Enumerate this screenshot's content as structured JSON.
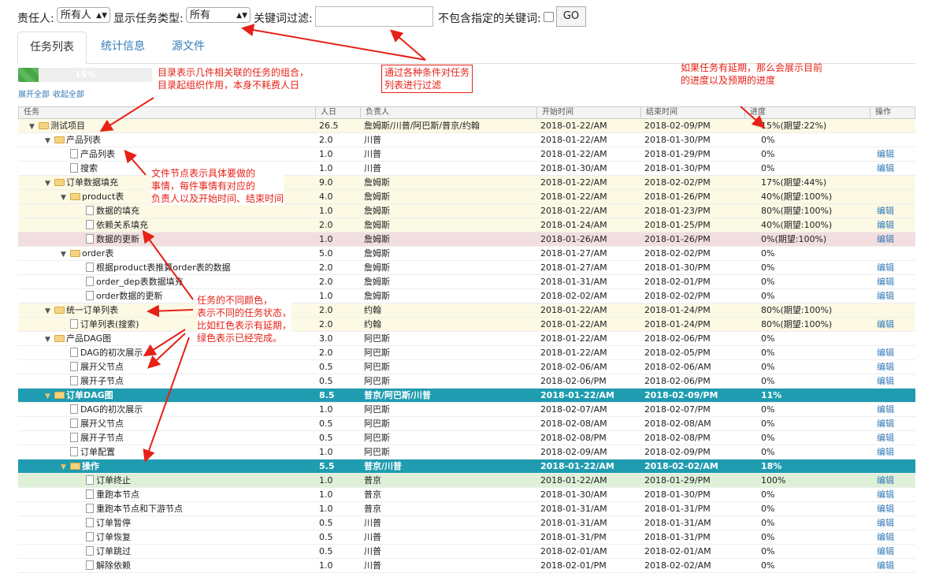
{
  "filters": {
    "owner_label": "责任人:",
    "owner_value": "所有人",
    "type_label": "显示任务类型:",
    "type_value": "所有",
    "keyword_label": "关键词过滤:",
    "keyword_value": "",
    "exclude_label": "不包含指定的关键词:",
    "go_label": "GO"
  },
  "tabs": [
    {
      "label": "任务列表",
      "active": true
    },
    {
      "label": "统计信息",
      "active": false
    },
    {
      "label": "源文件",
      "active": false
    }
  ],
  "progress": {
    "value": 0.15,
    "label": "15%"
  },
  "expand": {
    "expand_all": "展开全部",
    "collapse_all": "收起全部"
  },
  "columns": [
    "任务",
    "人日",
    "负责人",
    "开始时间",
    "结束时间",
    "进度",
    "操作"
  ],
  "rows": [
    {
      "name": "测试项目",
      "level": 0,
      "kind": "folder",
      "expanded": true,
      "days": "26.5",
      "owner": "詹姆斯/川普/阿巴斯/普京/约翰",
      "start": "2018-01-22/AM",
      "end": "2018-02-09/PM",
      "progress": "15%(期望:22%)",
      "action": "",
      "color": "yellow"
    },
    {
      "name": "产品列表",
      "level": 1,
      "kind": "folder",
      "expanded": true,
      "days": "2.0",
      "owner": "川普",
      "start": "2018-01-22/AM",
      "end": "2018-01-30/PM",
      "progress": "0%",
      "action": "",
      "color": ""
    },
    {
      "name": "产品列表",
      "level": 2,
      "kind": "file",
      "days": "1.0",
      "owner": "川普",
      "start": "2018-01-22/AM",
      "end": "2018-01-29/PM",
      "progress": "0%",
      "action": "编辑",
      "color": ""
    },
    {
      "name": "搜索",
      "level": 2,
      "kind": "file",
      "days": "1.0",
      "owner": "川普",
      "start": "2018-01-30/AM",
      "end": "2018-01-30/PM",
      "progress": "0%",
      "action": "编辑",
      "color": ""
    },
    {
      "name": "订单数据填充",
      "level": 1,
      "kind": "folder",
      "expanded": true,
      "days": "9.0",
      "owner": "詹姆斯",
      "start": "2018-01-22/AM",
      "end": "2018-02-02/PM",
      "progress": "17%(期望:44%)",
      "action": "",
      "color": "yellow"
    },
    {
      "name": "product表",
      "level": 2,
      "kind": "folder",
      "expanded": true,
      "days": "4.0",
      "owner": "詹姆斯",
      "start": "2018-01-22/AM",
      "end": "2018-01-26/PM",
      "progress": "40%(期望:100%)",
      "action": "",
      "color": "yellow"
    },
    {
      "name": "数据的填充",
      "level": 3,
      "kind": "file",
      "days": "1.0",
      "owner": "詹姆斯",
      "start": "2018-01-22/AM",
      "end": "2018-01-23/PM",
      "progress": "80%(期望:100%)",
      "action": "编辑",
      "color": "yellow"
    },
    {
      "name": "依赖关系填充",
      "level": 3,
      "kind": "file",
      "days": "2.0",
      "owner": "詹姆斯",
      "start": "2018-01-24/AM",
      "end": "2018-01-25/PM",
      "progress": "40%(期望:100%)",
      "action": "编辑",
      "color": "yellow"
    },
    {
      "name": "数据的更新",
      "level": 3,
      "kind": "file",
      "days": "1.0",
      "owner": "詹姆斯",
      "start": "2018-01-26/AM",
      "end": "2018-01-26/PM",
      "progress": "0%(期望:100%)",
      "action": "编辑",
      "color": "red"
    },
    {
      "name": "order表",
      "level": 2,
      "kind": "folder",
      "expanded": true,
      "days": "5.0",
      "owner": "詹姆斯",
      "start": "2018-01-27/AM",
      "end": "2018-02-02/PM",
      "progress": "0%",
      "action": "",
      "color": ""
    },
    {
      "name": "根据product表推算order表的数据",
      "level": 3,
      "kind": "file",
      "days": "2.0",
      "owner": "詹姆斯",
      "start": "2018-01-27/AM",
      "end": "2018-01-30/PM",
      "progress": "0%",
      "action": "编辑",
      "color": ""
    },
    {
      "name": "order_dep表数据填充",
      "level": 3,
      "kind": "file",
      "days": "2.0",
      "owner": "詹姆斯",
      "start": "2018-01-31/AM",
      "end": "2018-02-01/PM",
      "progress": "0%",
      "action": "编辑",
      "color": ""
    },
    {
      "name": "order数据的更新",
      "level": 3,
      "kind": "file",
      "days": "1.0",
      "owner": "詹姆斯",
      "start": "2018-02-02/AM",
      "end": "2018-02-02/PM",
      "progress": "0%",
      "action": "编辑",
      "color": ""
    },
    {
      "name": "统一订单列表",
      "level": 1,
      "kind": "folder",
      "expanded": true,
      "days": "2.0",
      "owner": "约翰",
      "start": "2018-01-22/AM",
      "end": "2018-01-24/PM",
      "progress": "80%(期望:100%)",
      "action": "",
      "color": "yellow"
    },
    {
      "name": "订单列表(搜索)",
      "level": 2,
      "kind": "file",
      "days": "2.0",
      "owner": "约翰",
      "start": "2018-01-22/AM",
      "end": "2018-01-24/PM",
      "progress": "80%(期望:100%)",
      "action": "编辑",
      "color": "yellow"
    },
    {
      "name": "产品DAG图",
      "level": 1,
      "kind": "folder",
      "expanded": true,
      "days": "3.0",
      "owner": "阿巴斯",
      "start": "2018-01-22/AM",
      "end": "2018-02-06/PM",
      "progress": "0%",
      "action": "",
      "color": ""
    },
    {
      "name": "DAG的初次展示",
      "level": 2,
      "kind": "file",
      "days": "2.0",
      "owner": "阿巴斯",
      "start": "2018-01-22/AM",
      "end": "2018-02-05/PM",
      "progress": "0%",
      "action": "编辑",
      "color": ""
    },
    {
      "name": "展开父节点",
      "level": 2,
      "kind": "file",
      "days": "0.5",
      "owner": "阿巴斯",
      "start": "2018-02-06/AM",
      "end": "2018-02-06/AM",
      "progress": "0%",
      "action": "编辑",
      "color": ""
    },
    {
      "name": "展开子节点",
      "level": 2,
      "kind": "file",
      "days": "0.5",
      "owner": "阿巴斯",
      "start": "2018-02-06/PM",
      "end": "2018-02-06/PM",
      "progress": "0%",
      "action": "编辑",
      "color": ""
    },
    {
      "name": "订单DAG图",
      "level": 1,
      "kind": "folder",
      "expanded": true,
      "days": "8.5",
      "owner": "普京/阿巴斯/川普",
      "start": "2018-01-22/AM",
      "end": "2018-02-09/PM",
      "progress": "11%",
      "action": "",
      "color": "blue"
    },
    {
      "name": "DAG的初次展示",
      "level": 2,
      "kind": "file",
      "days": "1.0",
      "owner": "阿巴斯",
      "start": "2018-02-07/AM",
      "end": "2018-02-07/PM",
      "progress": "0%",
      "action": "编辑",
      "color": ""
    },
    {
      "name": "展开父节点",
      "level": 2,
      "kind": "file",
      "days": "0.5",
      "owner": "阿巴斯",
      "start": "2018-02-08/AM",
      "end": "2018-02-08/AM",
      "progress": "0%",
      "action": "编辑",
      "color": ""
    },
    {
      "name": "展开子节点",
      "level": 2,
      "kind": "file",
      "days": "0.5",
      "owner": "阿巴斯",
      "start": "2018-02-08/PM",
      "end": "2018-02-08/PM",
      "progress": "0%",
      "action": "编辑",
      "color": ""
    },
    {
      "name": "订单配置",
      "level": 2,
      "kind": "file",
      "days": "1.0",
      "owner": "阿巴斯",
      "start": "2018-02-09/AM",
      "end": "2018-02-09/PM",
      "progress": "0%",
      "action": "编辑",
      "color": ""
    },
    {
      "name": "操作",
      "level": 2,
      "kind": "folder",
      "expanded": true,
      "days": "5.5",
      "owner": "普京/川普",
      "start": "2018-01-22/AM",
      "end": "2018-02-02/AM",
      "progress": "18%",
      "action": "",
      "color": "blue"
    },
    {
      "name": "订单终止",
      "level": 3,
      "kind": "file",
      "days": "1.0",
      "owner": "普京",
      "start": "2018-01-22/AM",
      "end": "2018-01-29/PM",
      "progress": "100%",
      "action": "编辑",
      "color": "green"
    },
    {
      "name": "重跑本节点",
      "level": 3,
      "kind": "file",
      "days": "1.0",
      "owner": "普京",
      "start": "2018-01-30/AM",
      "end": "2018-01-30/PM",
      "progress": "0%",
      "action": "编辑",
      "color": ""
    },
    {
      "name": "重跑本节点和下游节点",
      "level": 3,
      "kind": "file",
      "days": "1.0",
      "owner": "普京",
      "start": "2018-01-31/AM",
      "end": "2018-01-31/PM",
      "progress": "0%",
      "action": "编辑",
      "color": ""
    },
    {
      "name": "订单暂停",
      "level": 3,
      "kind": "file",
      "days": "0.5",
      "owner": "川普",
      "start": "2018-01-31/AM",
      "end": "2018-01-31/AM",
      "progress": "0%",
      "action": "编辑",
      "color": ""
    },
    {
      "name": "订单恢复",
      "level": 3,
      "kind": "file",
      "days": "0.5",
      "owner": "川普",
      "start": "2018-01-31/PM",
      "end": "2018-01-31/PM",
      "progress": "0%",
      "action": "编辑",
      "color": ""
    },
    {
      "name": "订单跳过",
      "level": 3,
      "kind": "file",
      "days": "0.5",
      "owner": "川普",
      "start": "2018-02-01/AM",
      "end": "2018-02-01/AM",
      "progress": "0%",
      "action": "编辑",
      "color": ""
    },
    {
      "name": "解除依赖",
      "level": 3,
      "kind": "file",
      "days": "1.0",
      "owner": "川普",
      "start": "2018-02-01/PM",
      "end": "2018-02-02/AM",
      "progress": "0%",
      "action": "编辑",
      "color": ""
    }
  ],
  "annotations": {
    "directory_note": "目录表示几件相关联的任务的组合，\n目录起组织作用，本身不耗费人日",
    "filter_note": "通过各种条件对任务\n列表进行过滤",
    "delay_note": "如果任务有延期，那么会展示目前\n的进度以及预期的进度",
    "file_note": "文件节点表示具体要做的\n事情，每件事情有对应的\n负责人以及开始时间、结束时间",
    "color_note": "任务的不同颜色，\n表示不同的任务状态，\n比如红色表示有延期，\n绿色表示已经完成。"
  },
  "colors": {
    "annotation": "#e62117",
    "highlight_row": "#1f9cb0",
    "delay_row": "#f2dede",
    "done_row": "#dff0d8",
    "partial_row": "#fcf9e5",
    "link": "#337ab7"
  }
}
